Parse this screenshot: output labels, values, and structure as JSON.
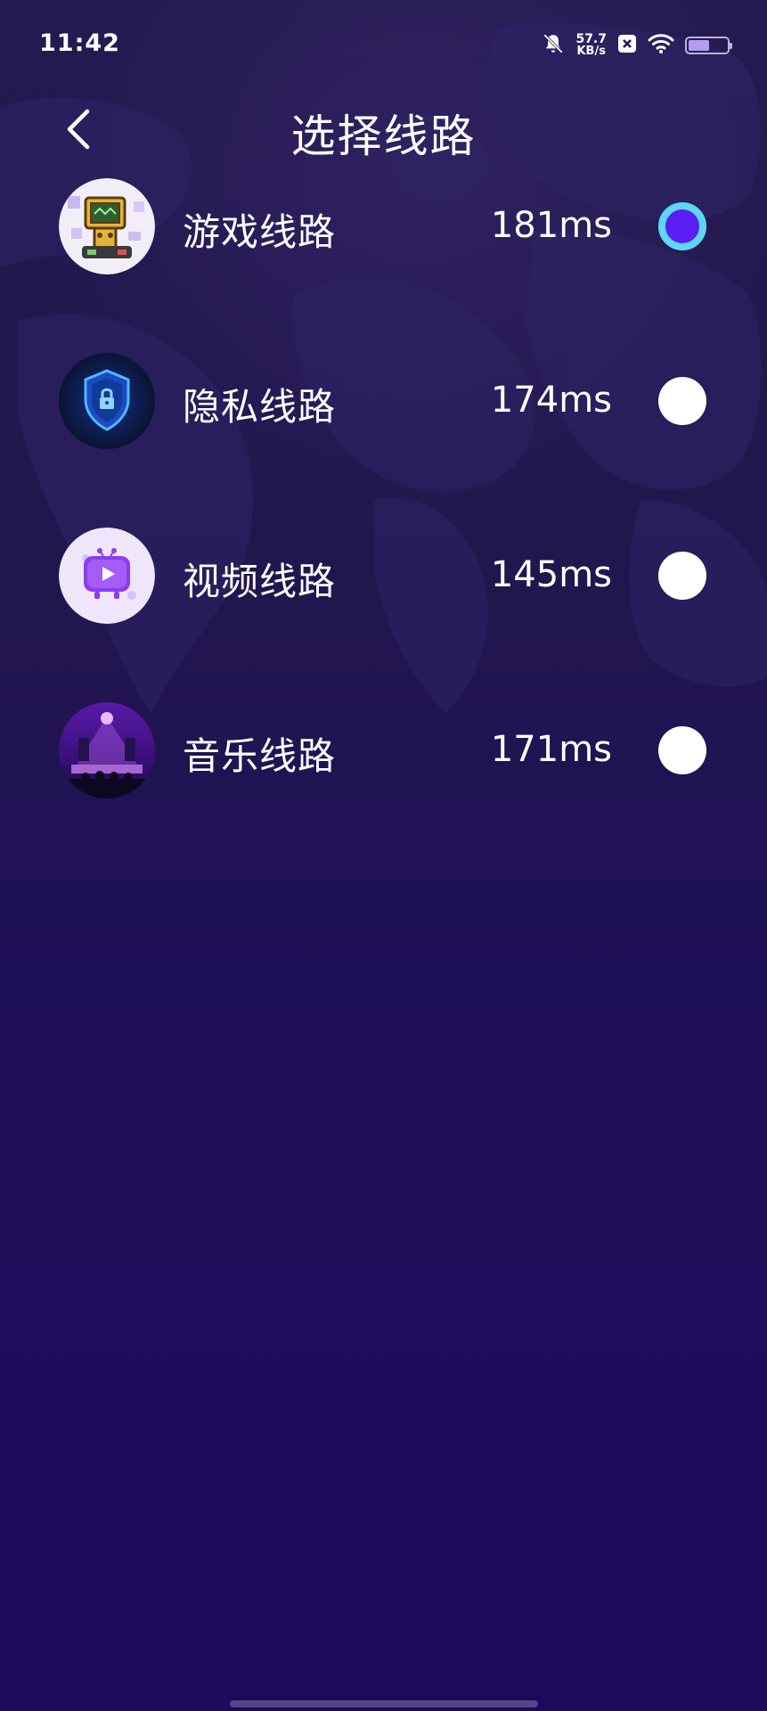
{
  "status_bar": {
    "time": "11:42",
    "net_speed_value": "57.7",
    "net_speed_unit": "KB/s",
    "icons": [
      "bell-muted-icon",
      "close-box-icon",
      "wifi-icon",
      "battery-icon"
    ],
    "battery_level": 0.55
  },
  "header": {
    "title": "选择线路",
    "back_icon": "chevron-left-icon"
  },
  "routes": [
    {
      "name": "游戏线路",
      "latency": "181ms",
      "selected": true,
      "icon": "game-robot-icon"
    },
    {
      "name": "隐私线路",
      "latency": "174ms",
      "selected": false,
      "icon": "shield-lock-icon"
    },
    {
      "name": "视频线路",
      "latency": "145ms",
      "selected": false,
      "icon": "video-play-icon"
    },
    {
      "name": "音乐线路",
      "latency": "171ms",
      "selected": false,
      "icon": "music-stage-icon"
    }
  ],
  "colors": {
    "background": "#1d0d57",
    "radio_selected_fill": "#5b1df2",
    "radio_selected_ring": "#5ed6f5",
    "radio_unselected": "#ffffff"
  }
}
